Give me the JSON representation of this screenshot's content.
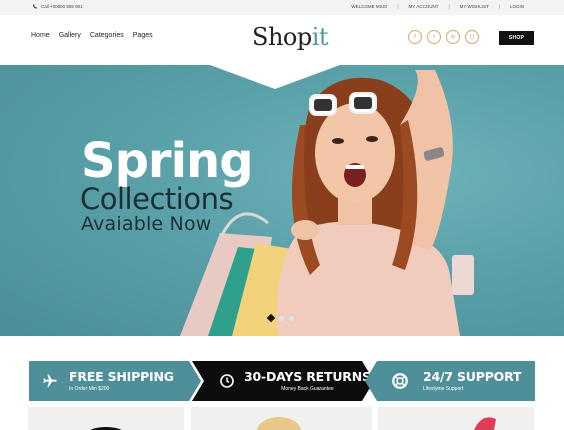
{
  "topbar": {
    "phone": "Call +00800 555 901",
    "links": [
      "WELCOME MSG!",
      "MY ACCOUNT",
      "MY WISHLIST",
      "LOGIN"
    ]
  },
  "header": {
    "nav": [
      "Home",
      "Gallery",
      "Categories",
      "Pages"
    ],
    "logo_main": "Shop",
    "logo_accent": "it",
    "socials": [
      {
        "icon": "facebook-icon",
        "glyph": "f"
      },
      {
        "icon": "twitter-icon",
        "glyph": "t"
      },
      {
        "icon": "dribbble-icon",
        "glyph": "◎"
      },
      {
        "icon": "instagram-icon",
        "glyph": "◻"
      }
    ],
    "shop_label": "SHOP"
  },
  "hero": {
    "title": "Spring",
    "subtitle": "Collections",
    "tagline": "Avaiable Now",
    "slides": 3,
    "active_slide": 1
  },
  "features": [
    {
      "icon": "airplane-icon",
      "title": "FREE SHIPPING",
      "subtitle": "In Order Min $200",
      "bg": "#4e8f99"
    },
    {
      "icon": "clock-icon",
      "title": "30-DAYS RETURNS",
      "subtitle": "Money Back  Guarantee",
      "bg": "#0d0d0d"
    },
    {
      "icon": "lifebuoy-icon",
      "title": "24/7 SUPPORT",
      "subtitle": "Lifestyme Support",
      "bg": "#4e8f99"
    }
  ],
  "colors": {
    "accent": "#4e9aa3",
    "hero_bg": "#5aa0a8",
    "social_border": "#d9a86c",
    "dark": "#111111"
  }
}
